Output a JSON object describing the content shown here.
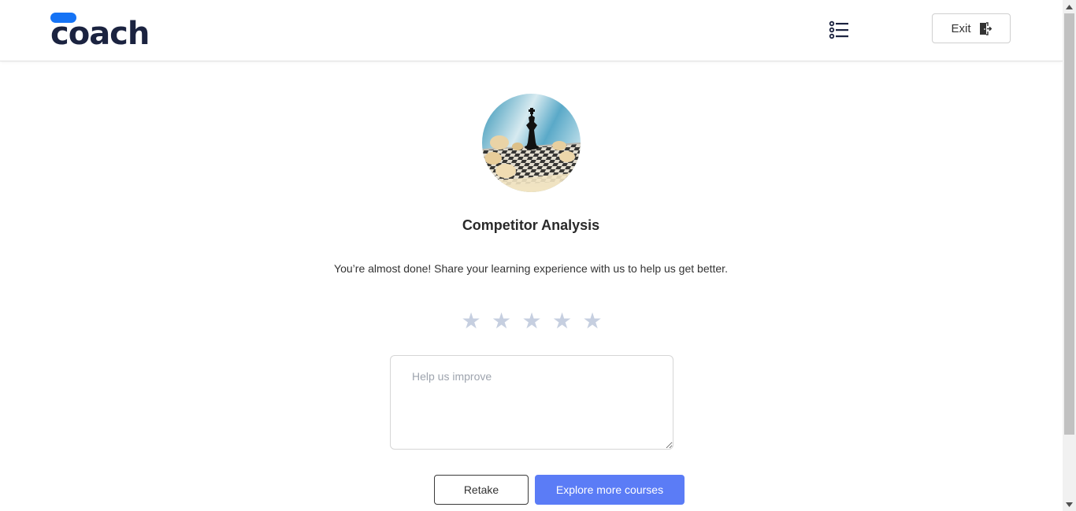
{
  "header": {
    "logo_text": "coach",
    "exit_label": "Exit"
  },
  "course": {
    "title": "Competitor Analysis",
    "image_icon": "chess-king-photo"
  },
  "feedback": {
    "prompt": "You’re almost done! Share your learning experience with us to help us get better.",
    "rating": 0,
    "rating_max": 5,
    "placeholder": "Help us improve",
    "value": ""
  },
  "actions": {
    "retake_label": "Retake",
    "explore_label": "Explore more courses"
  },
  "icons": {
    "menu": "list-icon",
    "exit": "door-exit-icon",
    "star": "star-icon"
  },
  "colors": {
    "brand_dark": "#1b2340",
    "brand_blue": "#1573f5",
    "primary_button": "#5b7cf6",
    "star_inactive": "#c6cfe0"
  }
}
